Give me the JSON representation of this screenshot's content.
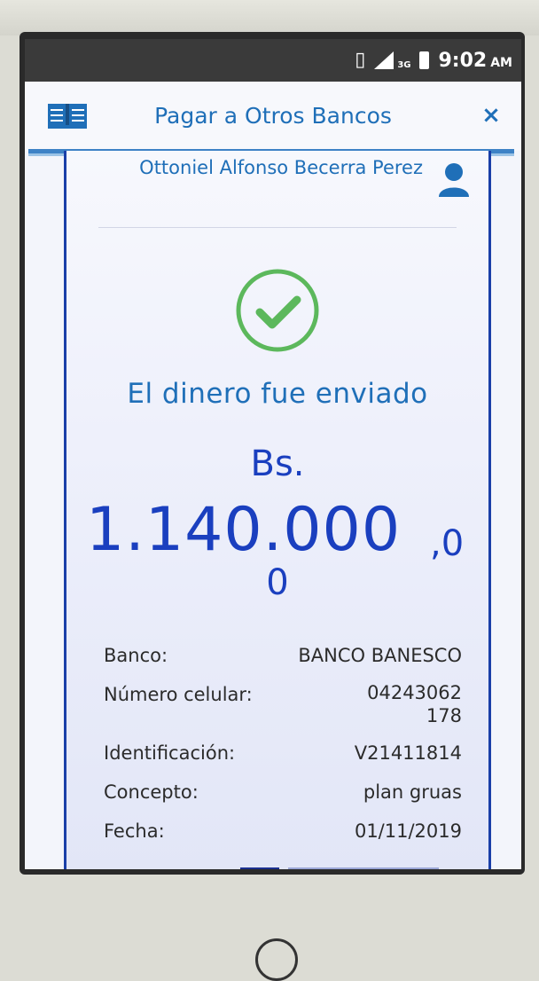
{
  "status_bar": {
    "network": "3G",
    "time": "9:02",
    "ampm": "AM"
  },
  "app_header": {
    "title": "Pagar a Otros Bancos",
    "close_label": "×"
  },
  "user": {
    "name": "Ottoniel Alfonso Becerra Perez"
  },
  "result": {
    "message": "El dinero fue enviado",
    "currency": "Bs.",
    "amount_main": "1.140.000",
    "amount_decimal_part1": ",0",
    "amount_decimal_part2": "0"
  },
  "details": [
    {
      "label": "Banco:",
      "value": "BANCO BANESCO"
    },
    {
      "label": "Número celular:",
      "value": "04243062\n178"
    },
    {
      "label": "Identificación:",
      "value": "V21411814"
    },
    {
      "label": "Concepto:",
      "value": "plan gruas"
    },
    {
      "label": "Fecha:",
      "value": "01/11/2019"
    }
  ],
  "colors": {
    "accent": "#1f6fb8",
    "amount": "#1a3fbf",
    "success": "#5cb85c"
  }
}
